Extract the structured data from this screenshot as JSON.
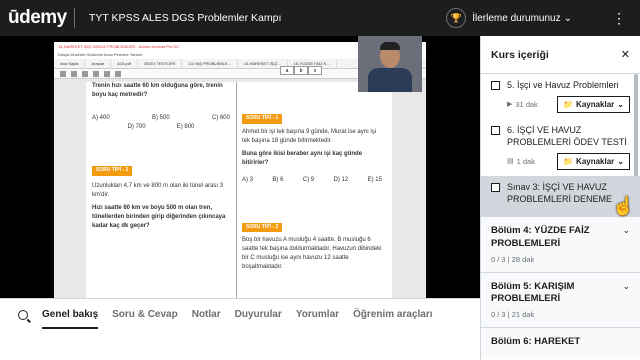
{
  "header": {
    "logo": "ūdemy",
    "course_title": "TYT KPSS ALES DGS Problemler Kampı",
    "progress_label": "İlerleme durumunuz",
    "more": "⋮"
  },
  "video": {
    "pdf_title": "14-HAREKET İŞÇİ HAVUZ PROBLEMLERİ - Adobe Acrobat Pro DC",
    "menu": "Dosya   Düzenle   Görünüm   İmza   Pencere   Yardım",
    "tabs": [
      "Ana Sayfa",
      "Araçlar",
      "A15.pdf",
      "ÖDEV TESTLERİ",
      "13-YAŞ PROBLEMLE...",
      "14-HAREKET İŞÇİ...",
      "15-YÜZDE FAİZ K..."
    ],
    "abx": [
      "a",
      "b",
      "x"
    ],
    "left_col": {
      "q1": "Trenin hızı saatte 60 km olduğuna göre, trenin boyu kaç metredir?",
      "opts_row1": [
        "A) 400",
        "B) 500",
        "C) 600"
      ],
      "opts_row2": [
        "D) 700",
        "E) 800"
      ],
      "badge": "SORU TİPİ - 2",
      "p1": "Uzunlukları 4,7 km ve 800 m olan iki tünel arası 3 km'dir.",
      "q2": "Hızı saatte 60 km ve boyu 500 m olan tren, tünellerden birinden girip diğerinden çıkıncaya kadar kaç dk geçer?"
    },
    "right_col": {
      "badge1": "SORU TİPİ - 1",
      "p1": "Ahmet bir işi tek başına 9 günde, Murat ise aynı işi tek başına 18 günde bitirmektedir.",
      "q1": "Buna göre ikisi beraber aynı işi kaç günde bitirirler?",
      "opts": [
        "A) 3",
        "B) 6",
        "C) 9",
        "D) 12",
        "E) 15"
      ],
      "badge2": "SORU TİPİ - 2",
      "p2": "Boş bir havuzu A musluğu 4 saatte, B musluğu 6 saatte tek başına doldurmaktadır. Havuzun dibindeki bir C musluğu ise aynı havuzu 12 saatte boşaltmaktadır."
    }
  },
  "tabs": [
    {
      "label": "Genel bakış",
      "active": true
    },
    {
      "label": "Soru & Cevap",
      "active": false
    },
    {
      "label": "Notlar",
      "active": false
    },
    {
      "label": "Duyurular",
      "active": false
    },
    {
      "label": "Yorumlar",
      "active": false
    },
    {
      "label": "Öğrenim araçları",
      "active": false
    }
  ],
  "sidebar": {
    "title": "Kurs içeriği",
    "close": "✕",
    "items": [
      {
        "title": "5. İşçi ve Havuz Problemleri",
        "duration": "31 dak",
        "resources": "Kaynaklar"
      },
      {
        "title": "6. İŞÇİ VE HAVUZ PROBLEMLERİ ÖDEV TESTİ",
        "duration": "1 dak",
        "resources": "Kaynaklar"
      },
      {
        "title": "Sınav 3: İŞÇİ VE HAVUZ PROBLEMLERİ DENEME"
      }
    ],
    "sections": [
      {
        "title": "Bölüm 4: YÜZDE FAİZ PROBLEMLERİ",
        "meta": "0 / 3 | 28 dak"
      },
      {
        "title": "Bölüm 5: KARIŞIM PROBLEMLERİ",
        "meta": "0 / 3 | 21 dak"
      },
      {
        "title": "Bölüm 6: HAREKET",
        "meta": ""
      }
    ]
  }
}
